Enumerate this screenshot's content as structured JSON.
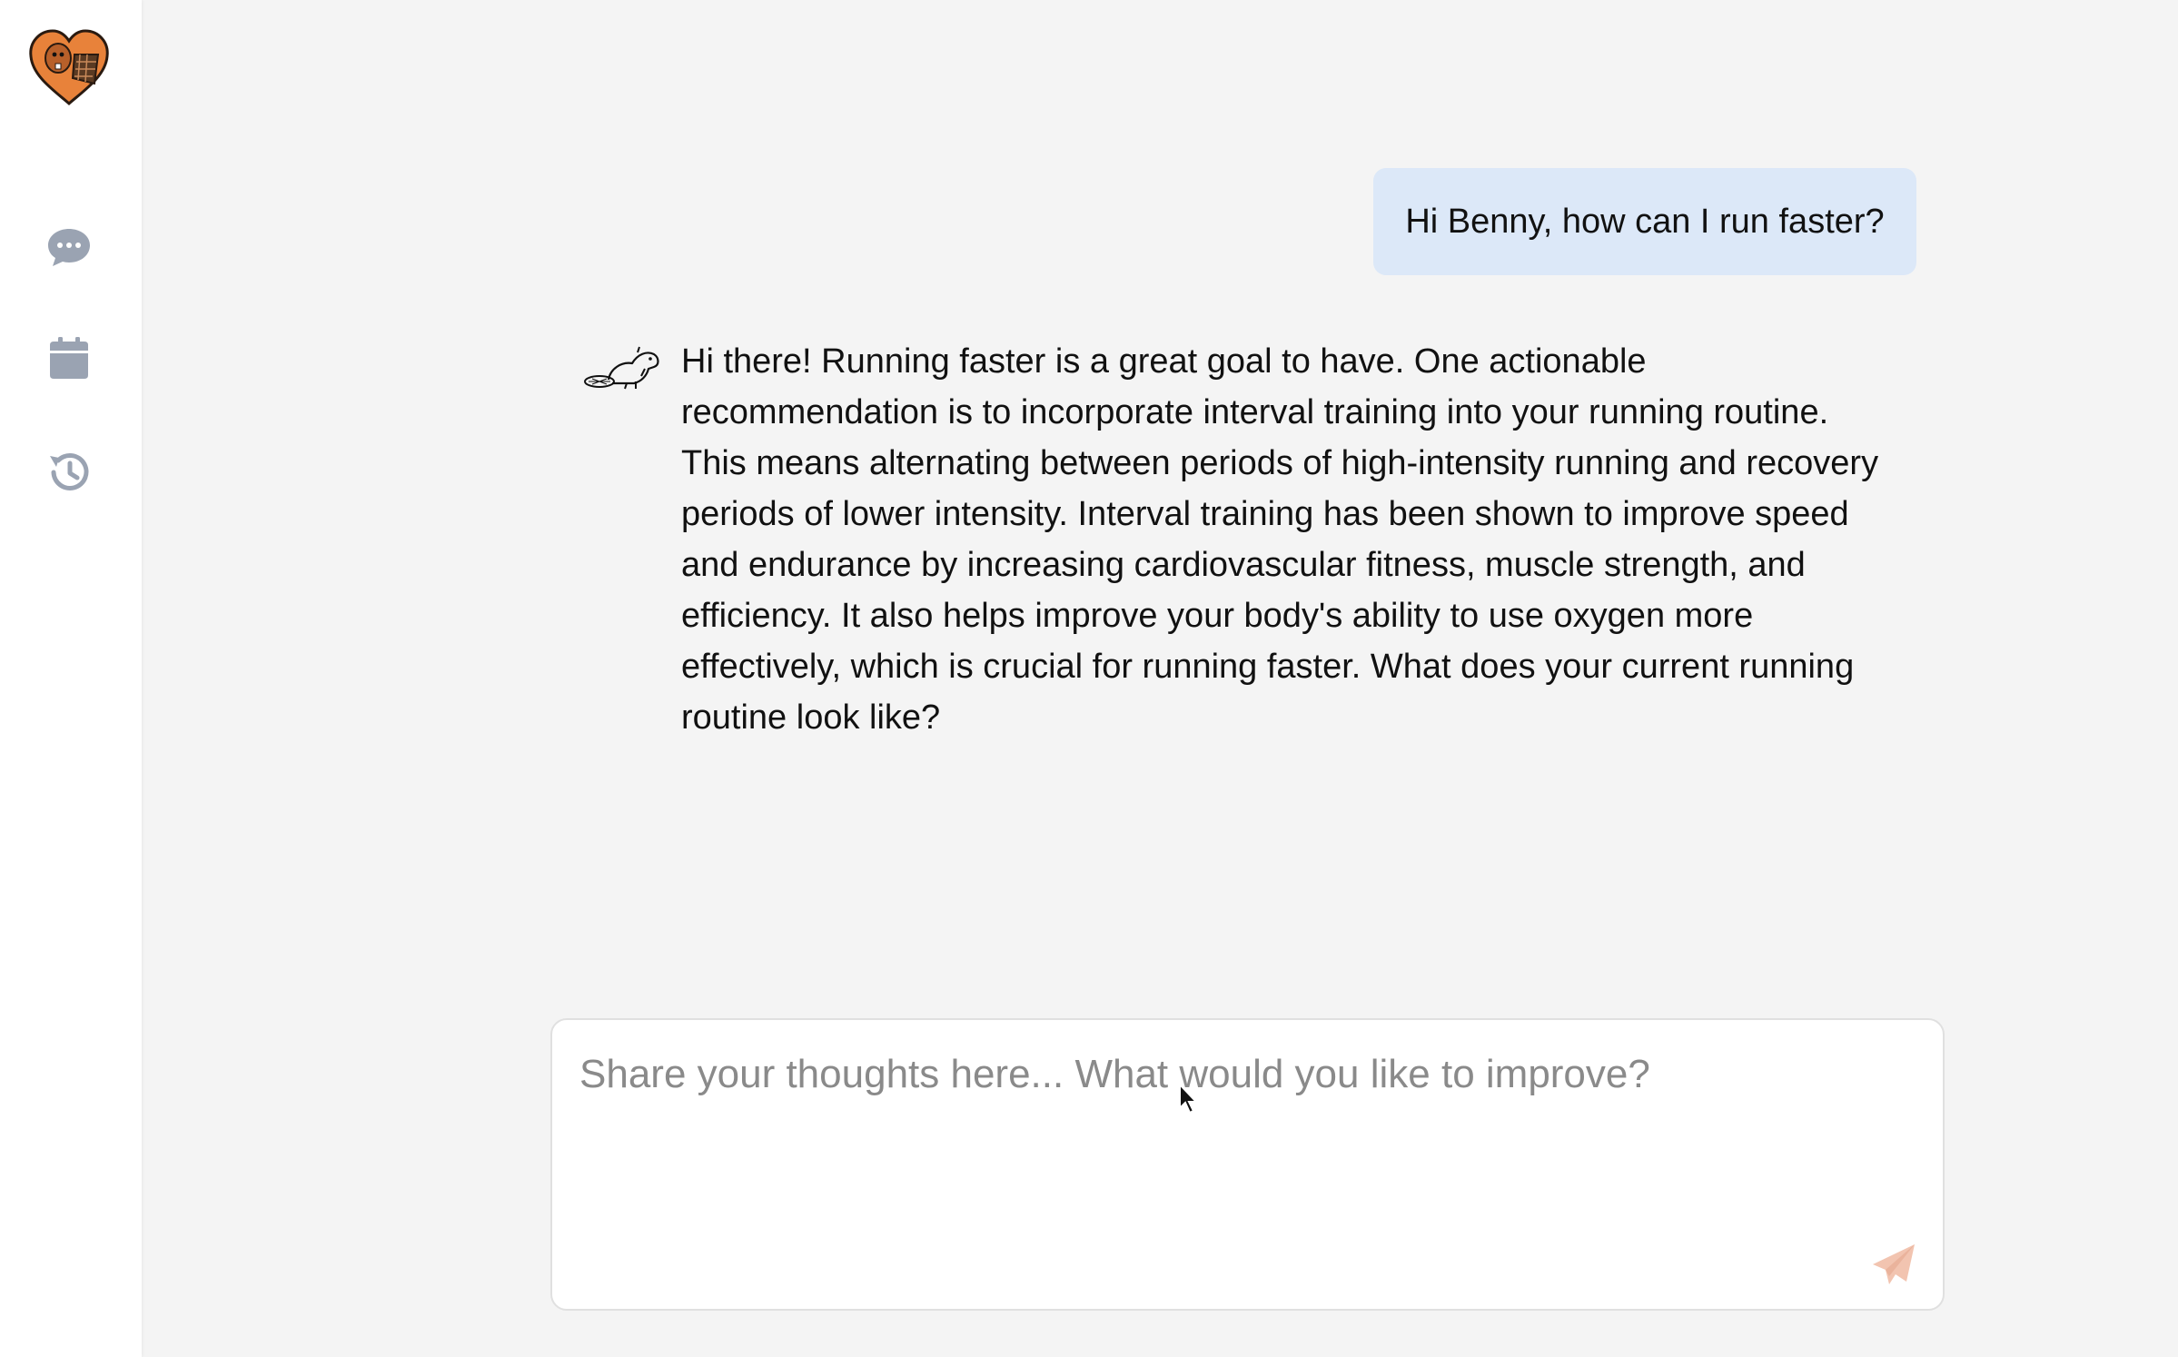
{
  "colors": {
    "accent": "#e8823a",
    "sidebar_icon": "#9aa3b2",
    "user_bubble": "#dce8f8",
    "send_icon": "#f2c4b0"
  },
  "sidebar": {
    "logo_icon": "beaver-heart-logo",
    "items": [
      {
        "icon": "chat-bubble-icon",
        "name": "chat"
      },
      {
        "icon": "calendar-icon",
        "name": "calendar"
      },
      {
        "icon": "history-icon",
        "name": "history"
      }
    ]
  },
  "conversation": {
    "messages": [
      {
        "role": "user",
        "text": "Hi Benny, how can I run faster?"
      },
      {
        "role": "assistant",
        "avatar_icon": "beaver-icon",
        "text": "Hi there! Running faster is a great goal to have. One actionable recommendation is to incorporate interval training into your running routine. This means alternating between periods of high-intensity running and recovery periods of lower intensity. Interval training has been shown to improve speed and endurance by increasing cardiovascular fitness, muscle strength, and efficiency. It also helps improve your body's ability to use oxygen more effectively, which is crucial for running faster. What does your current running routine look like?"
      }
    ]
  },
  "composer": {
    "placeholder": "Share your thoughts here... What would you like to improve?",
    "value": "",
    "send_icon": "paper-plane-icon"
  }
}
